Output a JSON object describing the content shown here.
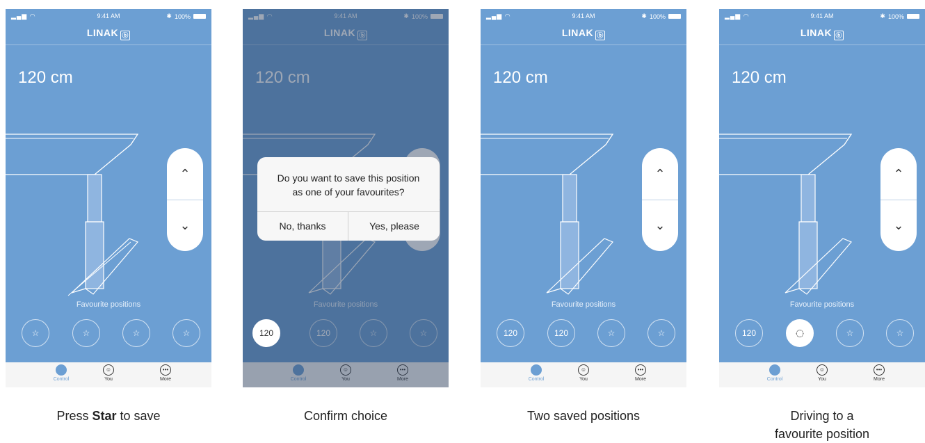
{
  "statusbar": {
    "time": "9:41 AM",
    "battery": "100%"
  },
  "brand": "LINAK",
  "height_value": "120 cm",
  "favourites_label": "Favourite positions",
  "tabs": [
    {
      "label": "Control"
    },
    {
      "label": "You"
    },
    {
      "label": "More"
    }
  ],
  "dialog": {
    "line1": "Do you want to save this position",
    "line2": "as one of your favourites?",
    "no_label": "No, thanks",
    "yes_label": "Yes, please"
  },
  "screens": [
    {
      "caption_pre": "Press ",
      "caption_bold": "Star",
      "caption_post": " to save",
      "favs": [
        "",
        "",
        "",
        ""
      ]
    },
    {
      "caption": "Confirm choice",
      "favs": [
        "120",
        "120",
        "",
        ""
      ]
    },
    {
      "caption": "Two saved positions",
      "favs": [
        "120",
        "120",
        "",
        ""
      ]
    },
    {
      "caption_line1": "Driving to a",
      "caption_line2": "favourite position",
      "favs": [
        "120",
        "",
        "",
        ""
      ]
    }
  ],
  "colors": {
    "screen_bg": "#6c9fd3",
    "tabbar_bg": "#f5f5f5",
    "accent": "#6c9fd3"
  }
}
